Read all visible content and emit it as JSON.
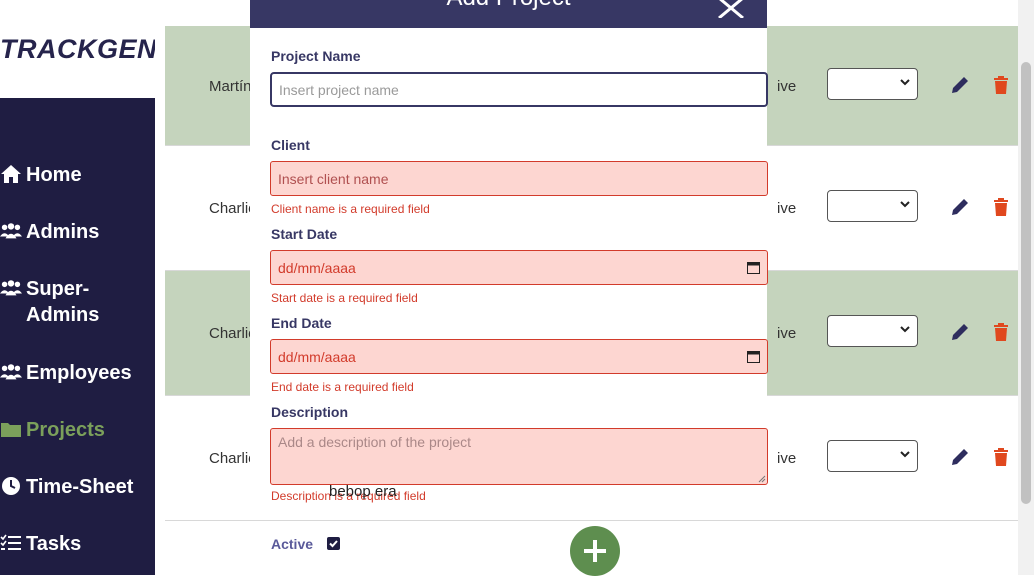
{
  "brand": "TRACKGENIX",
  "nav": [
    {
      "label": "Home",
      "icon": "home-icon"
    },
    {
      "label": "Admins",
      "icon": "users-icon"
    },
    {
      "label": "Super-Admins",
      "icon": "users-icon"
    },
    {
      "label": "Employees",
      "icon": "users-icon"
    },
    {
      "label": "Projects",
      "icon": "folder-icon",
      "active": true
    },
    {
      "label": "Time-Sheet",
      "icon": "clock-icon"
    },
    {
      "label": "Tasks",
      "icon": "tasks-icon"
    }
  ],
  "rows": [
    {
      "name": "Martín",
      "status": "ive"
    },
    {
      "name": "Charlie",
      "status": "ive"
    },
    {
      "name": "Charlie",
      "status": "ive"
    },
    {
      "name": "Charlie",
      "status": "ive"
    }
  ],
  "modal": {
    "title": "Add Project",
    "project_name": {
      "label": "Project Name",
      "placeholder": "Insert project name"
    },
    "client": {
      "label": "Client",
      "placeholder": "Insert client name",
      "error": "Client name is a required field"
    },
    "start_date": {
      "label": "Start Date",
      "placeholder": "dd/mm/aaaa",
      "error": "Start date is a required field"
    },
    "end_date": {
      "label": "End Date",
      "placeholder": "dd/mm/aaaa",
      "error": "End date is a required field"
    },
    "description": {
      "label": "Description",
      "placeholder": "Add a description of the project",
      "error": "Description is a required field"
    }
  },
  "overlay_text": "bebop era",
  "active_label": "Active",
  "colors": {
    "sidebar": "#1f1d42",
    "accent": "#7ba05b",
    "header": "#373764",
    "error": "#d23b2b",
    "delete": "#e0481e"
  }
}
